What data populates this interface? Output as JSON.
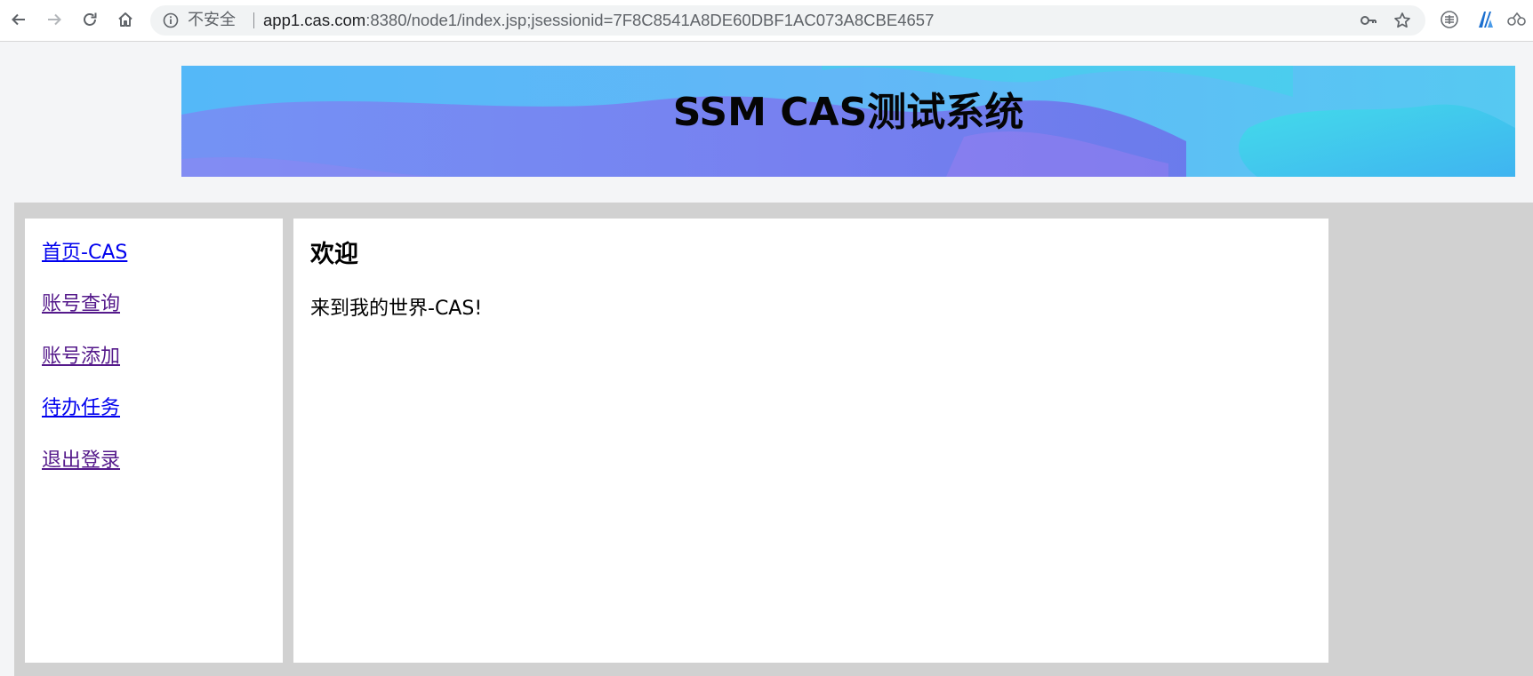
{
  "browser": {
    "security_label": "不安全",
    "url_host": "app1.cas.com",
    "url_rest": ":8380/node1/index.jsp;jsessionid=7F8C8541A8DE60DBF1AC073A8CBE4657",
    "icons": [
      "back-arrow-icon",
      "forward-arrow-icon",
      "reload-icon",
      "home-icon",
      "info-icon",
      "key-icon",
      "star-icon",
      "extension-icon",
      "profile-logo-icon",
      "cloud-extension-icon"
    ]
  },
  "banner": {
    "title": "SSM CAS测试系统",
    "colors": {
      "gradient_start": "#6fa6f6",
      "gradient_mid": "#52b6f8",
      "gradient_accent": "#4fd0ee",
      "gradient_end": "#3aa4f2"
    }
  },
  "sidebar": {
    "items": [
      {
        "label": "首页-CAS",
        "state": "unvisited"
      },
      {
        "label": "账号查询",
        "state": "visited"
      },
      {
        "label": "账号添加",
        "state": "visited"
      },
      {
        "label": "待办任务",
        "state": "unvisited"
      },
      {
        "label": "退出登录",
        "state": "visited"
      }
    ]
  },
  "content": {
    "heading": "欢迎",
    "text": "来到我的世界-CAS!"
  },
  "colors": {
    "page_background": "#f4f5f7",
    "frame_background": "#d1d1d1",
    "link_unvisited": "#0000ee",
    "link_visited": "#551a8b"
  }
}
